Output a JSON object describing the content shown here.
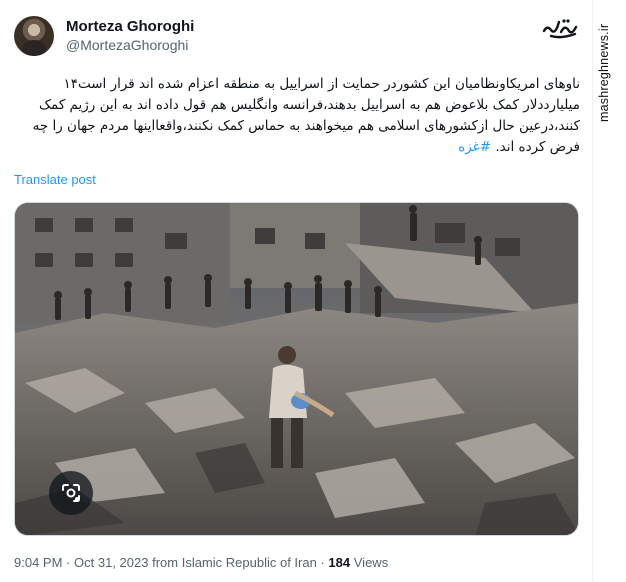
{
  "author": {
    "display_name": "Morteza Ghoroghi",
    "handle": "@MortezaGhoroghi"
  },
  "tweet": {
    "text": "ناوهای امریکاونظامیان این کشوردر حمایت از اسراییل به منطقه اعزام شده اند قرار است۱۴ میلیارددلار کمک بلاعوض هم به اسراییل بدهند،فرانسه وانگلیس هم قول داده اند به این رژیم کمک کنند،درعین حال ازکشورهای اسلامی هم میخواهند به حماس کمک نکنند،واقعااینها مردم جهان را چه فرض کرده اند.",
    "hashtag": "#غزه",
    "translate_label": "Translate post"
  },
  "meta": {
    "time": "9:04 PM",
    "date": "Oct 31, 2023",
    "source": "from Islamic Republic of Iran",
    "views_count": "184",
    "views_label": "Views",
    "separator": "·"
  },
  "watermark": {
    "logo_text": "مشرق",
    "site": "mashreghnews.ir"
  },
  "colors": {
    "accent": "#1d9bf0",
    "text_primary": "#0f1419",
    "text_secondary": "#536471"
  },
  "icons": {
    "lens": "google-lens-icon",
    "logo": "mashregh-logo"
  }
}
